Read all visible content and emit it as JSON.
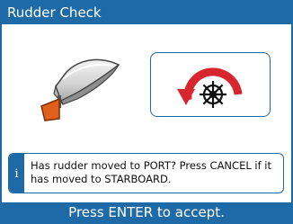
{
  "title": "Rudder Check",
  "info": {
    "icon": "info-icon",
    "icon_glyph": "i",
    "message": "Has rudder moved to PORT? Press CANCEL if it has moved to STARBOARD."
  },
  "footer": {
    "instruction": "Press ENTER to accept."
  },
  "illustrations": {
    "boat": "boat-with-rudder-icon",
    "helm": "helm-wheel-turn-port-icon"
  },
  "colors": {
    "accent": "#1e6aa6",
    "rudder": "#e0601b",
    "arrow": "#d8262e"
  }
}
